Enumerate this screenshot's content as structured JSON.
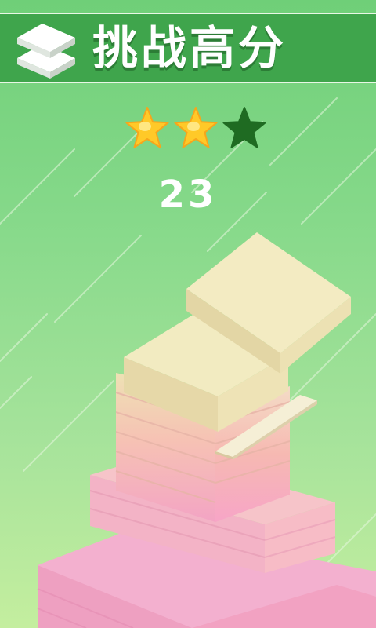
{
  "header": {
    "title": "挑战高分",
    "logo_icon": "stacked-blocks-icon"
  },
  "progress": {
    "stars_total": 3,
    "stars_earned": 2,
    "earned_color": "#ffc928",
    "empty_color": "#1f6b22"
  },
  "game": {
    "score": "23"
  },
  "colors": {
    "background_top": "#6fcf78",
    "background_bottom": "#c4ee9f",
    "banner": "#3fa54c",
    "block_top": "#f2ebc1",
    "block_base": "#f1a6c3"
  }
}
